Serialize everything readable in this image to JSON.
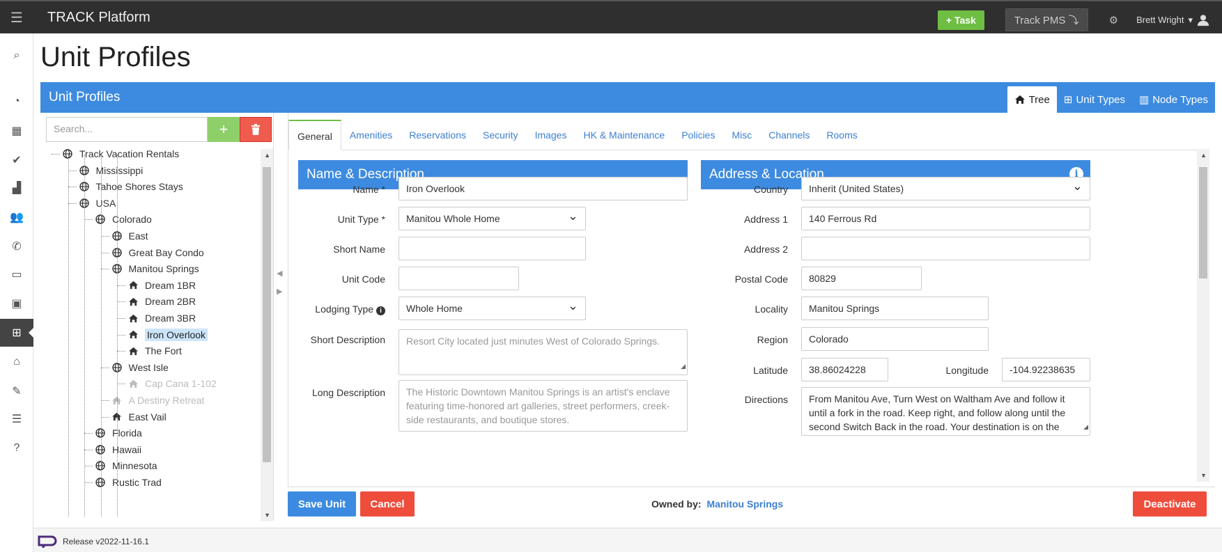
{
  "header": {
    "brand": "TRACK Platform",
    "task_label": "Task",
    "pms_label": "Track PMS",
    "user_name": "Brett Wright"
  },
  "page": {
    "title": "Unit Profiles"
  },
  "panel": {
    "title": "Unit Profiles",
    "view_tabs": [
      {
        "label": "Tree",
        "icon": "home-icon",
        "active": true
      },
      {
        "label": "Unit Types",
        "icon": "grid-icon",
        "active": false
      },
      {
        "label": "Node Types",
        "icon": "map-icon",
        "active": false
      }
    ]
  },
  "tree": {
    "search_placeholder": "Search...",
    "items": [
      {
        "label": "Track Vacation Rentals",
        "type": "node",
        "depth": 0
      },
      {
        "label": "Mississippi",
        "type": "node",
        "depth": 1
      },
      {
        "label": "Tahoe Shores Stays",
        "type": "node",
        "depth": 1
      },
      {
        "label": "USA",
        "type": "node",
        "depth": 1
      },
      {
        "label": "Colorado",
        "type": "node",
        "depth": 2
      },
      {
        "label": "East",
        "type": "node",
        "depth": 3
      },
      {
        "label": "Great Bay Condo",
        "type": "node",
        "depth": 3
      },
      {
        "label": "Manitou Springs",
        "type": "node",
        "depth": 3
      },
      {
        "label": "Dream 1BR",
        "type": "unit",
        "depth": 4
      },
      {
        "label": "Dream 2BR",
        "type": "unit",
        "depth": 4
      },
      {
        "label": "Dream 3BR",
        "type": "unit",
        "depth": 4
      },
      {
        "label": "Iron Overlook",
        "type": "unit",
        "depth": 4,
        "selected": true
      },
      {
        "label": "The Fort",
        "type": "unit",
        "depth": 4
      },
      {
        "label": "West Isle",
        "type": "node",
        "depth": 3
      },
      {
        "label": "Cap Cana 1-102",
        "type": "unit",
        "depth": 4,
        "disabled": true
      },
      {
        "label": "A Destiny Retreat",
        "type": "unit",
        "depth": 3,
        "disabled": true
      },
      {
        "label": "East Vail",
        "type": "unit",
        "depth": 3
      },
      {
        "label": "Florida",
        "type": "node",
        "depth": 2
      },
      {
        "label": "Hawaii",
        "type": "node",
        "depth": 2
      },
      {
        "label": "Minnesota",
        "type": "node",
        "depth": 2
      },
      {
        "label": "Rustic Trad",
        "type": "node",
        "depth": 2
      }
    ]
  },
  "tabs": [
    "General",
    "Amenities",
    "Reservations",
    "Security",
    "Images",
    "HK & Maintenance",
    "Policies",
    "Misc",
    "Channels",
    "Rooms"
  ],
  "name_section": {
    "title": "Name & Description",
    "name_label": "Name *",
    "name_value": "Iron Overlook",
    "unit_type_label": "Unit Type *",
    "unit_type_value": "Manitou Whole Home",
    "short_name_label": "Short Name",
    "short_name_value": "",
    "unit_code_label": "Unit Code",
    "unit_code_value": "",
    "lodging_type_label": "Lodging Type",
    "lodging_type_value": "Whole Home",
    "short_desc_label": "Short Description",
    "short_desc_placeholder": "Resort City located just minutes West of Colorado Springs.",
    "long_desc_label": "Long Description",
    "long_desc_placeholder": "The Historic Downtown Manitou Springs is an artist's enclave featuring time-honored art galleries, street performers, creek-side restaurants, and boutique stores."
  },
  "address_section": {
    "title": "Address & Location",
    "country_label": "Country",
    "country_value": "Inherit (United States)",
    "address1_label": "Address 1",
    "address1_value": "140 Ferrous Rd",
    "address2_label": "Address 2",
    "address2_value": "",
    "postal_label": "Postal Code",
    "postal_value": "80829",
    "locality_label": "Locality",
    "locality_value": "Manitou Springs",
    "region_label": "Region",
    "region_value": "Colorado",
    "latitude_label": "Latitude",
    "latitude_value": "38.86024228",
    "longitude_label": "Longitude",
    "longitude_value": "-104.92238635",
    "directions_label": "Directions",
    "directions_value": "From Manitou Ave, Turn West on Waltham Ave and follow it until a fork in the road. Keep right, and follow along until the second Switch Back in the road. Your destination is on the right."
  },
  "footer": {
    "save_label": "Save Unit",
    "cancel_label": "Cancel",
    "owned_label": "Owned by:",
    "owned_value": "Manitou Springs",
    "deactivate_label": "Deactivate",
    "release": "Release v2022-11-16.1"
  },
  "colors": {
    "primary": "#3d8be0",
    "success": "#6fbe44",
    "danger": "#ef4d3c",
    "topbar": "#2f2f2f"
  }
}
